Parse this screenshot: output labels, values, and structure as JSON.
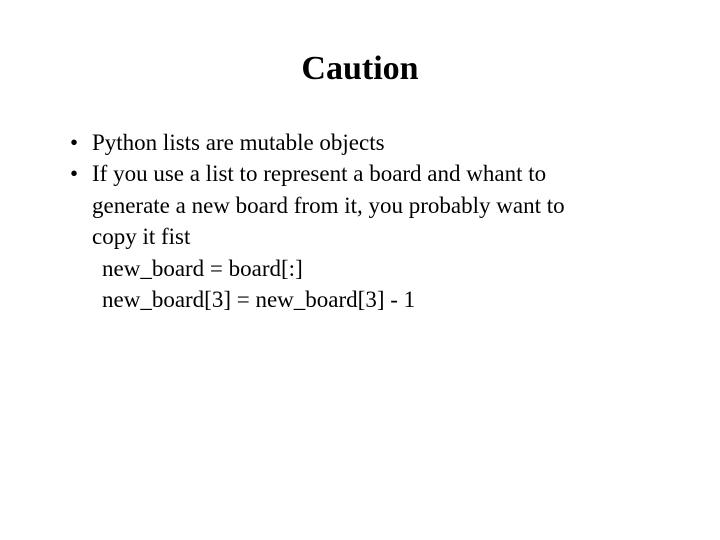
{
  "title": "Caution",
  "bullets": [
    "Python lists are mutable objects",
    "If you use a list to represent a board and whant to"
  ],
  "cont": [
    "generate a new board from it, you probably want to",
    "copy it fist"
  ],
  "code": [
    "new_board = board[:]",
    "new_board[3] = new_board[3] - 1"
  ]
}
